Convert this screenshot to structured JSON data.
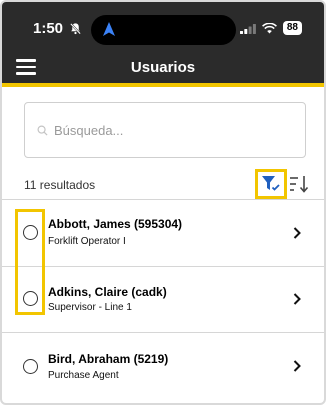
{
  "status_bar": {
    "time": "1:50",
    "battery": "88"
  },
  "header": {
    "title": "Usuarios"
  },
  "search": {
    "placeholder": "Búsqueda..."
  },
  "results": {
    "count_label": "11 resultados"
  },
  "users": [
    {
      "name": "Abbott, James (595304)",
      "role": "Forklift Operator I"
    },
    {
      "name": "Adkins, Claire (cadk)",
      "role": "Supervisor - Line 1"
    },
    {
      "name": "Bird, Abraham (5219)",
      "role": "Purchase Agent"
    }
  ],
  "colors": {
    "header_bg": "#2b2b2b",
    "accent": "#f2c500",
    "filter_icon": "#1f5fbf"
  },
  "icons": {
    "menu": "hamburger-icon",
    "search": "search-icon",
    "filter": "filter-icon",
    "sort": "sort-icon",
    "chevron": "chevron-right-icon"
  }
}
